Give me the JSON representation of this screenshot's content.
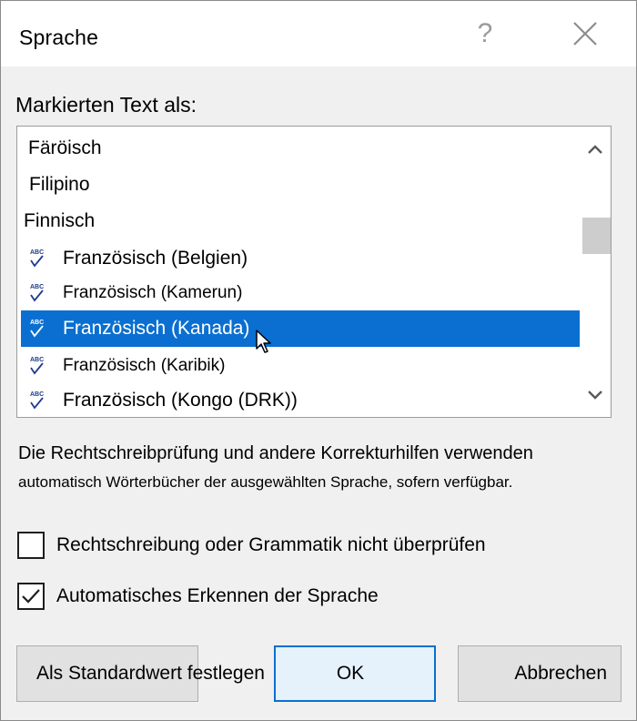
{
  "dialog": {
    "title": "Sprache",
    "help_symbol": "?",
    "close_icon": "close-icon"
  },
  "list": {
    "label": "Markierten Text als:",
    "items": [
      {
        "label": "Färöisch",
        "has_spell_icon": false,
        "selected": false
      },
      {
        "label": "Filipino",
        "has_spell_icon": false,
        "selected": false
      },
      {
        "label": "Finnisch",
        "has_spell_icon": false,
        "selected": false
      },
      {
        "label": "Französisch (Belgien)",
        "has_spell_icon": true,
        "selected": false
      },
      {
        "label": "Französisch (Kamerun)",
        "has_spell_icon": true,
        "selected": false
      },
      {
        "label": "Französisch (Kanada)",
        "has_spell_icon": true,
        "selected": true
      },
      {
        "label": "Französisch (Karibik)",
        "has_spell_icon": true,
        "selected": false
      },
      {
        "label": "Französisch (Kongo (DRK))",
        "has_spell_icon": true,
        "selected": false
      }
    ],
    "spell_icon_text": "ABC"
  },
  "description": {
    "line1": "Die Rechtschreibprüfung und andere Korrekturhilfen verwenden",
    "line2": "automatisch Wörterbücher der ausgewählten Sprache, sofern verfügbar."
  },
  "options": {
    "no_proofing": {
      "label": "Rechtschreibung oder Grammatik nicht überprüfen",
      "checked": false
    },
    "auto_detect": {
      "label": "Automatisches Erkennen der Sprache",
      "checked": true
    }
  },
  "buttons": {
    "set_default": "Als Standardwert festlegen",
    "ok": "OK",
    "cancel": "Abbrechen"
  },
  "colors": {
    "selection": "#0a6fd0",
    "dialog_bg": "#f0f0f0",
    "spell_icon": "#1f3b8c"
  }
}
